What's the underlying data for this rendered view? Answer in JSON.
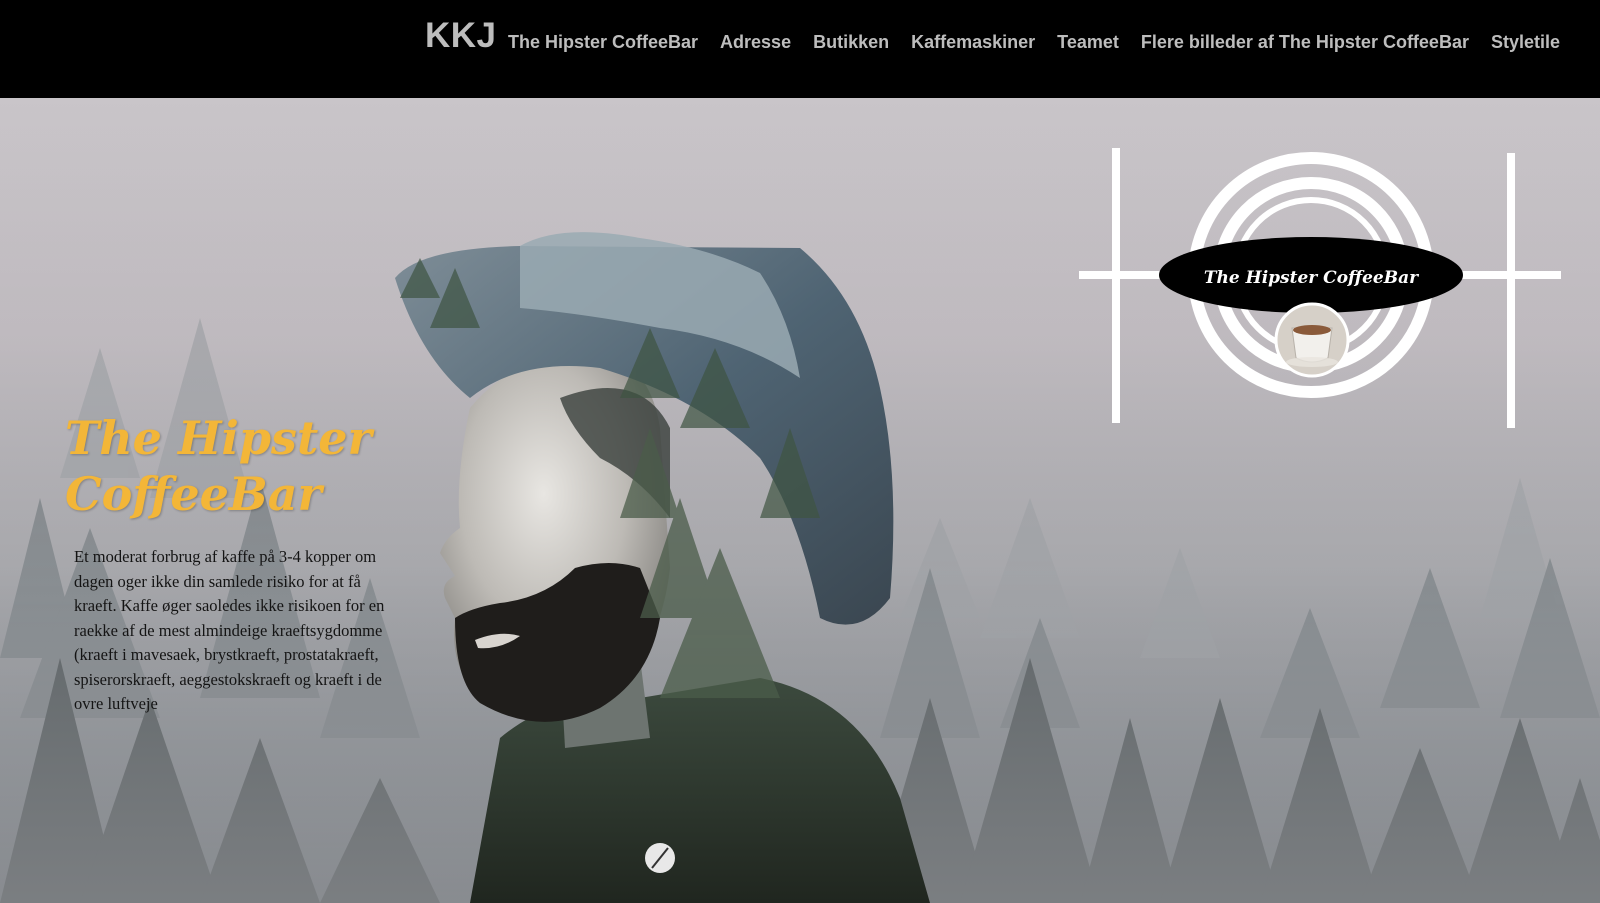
{
  "nav": {
    "brand": "KKJ",
    "items": [
      {
        "label": "The Hipster CoffeeBar"
      },
      {
        "label": "Adresse"
      },
      {
        "label": "Butikken"
      },
      {
        "label": "Kaffemaskiner"
      },
      {
        "label": "Teamet"
      },
      {
        "label": "Flere billeder af The Hipster CoffeeBar"
      },
      {
        "label": "Styletile"
      }
    ]
  },
  "hero": {
    "title_line1": "The Hipster",
    "title_line2": "CoffeeBar",
    "body": "Et moderat forbrug af kaffe på 3-4 kopper om dagen oger ikke din samlede risiko for at få kraeft. Kaffe øger saoledes ikke risikoen for en raekke af de mest almindeige kraeftsygdomme (kraeft i mavesaek, brystkraeft, prostatakraeft, spiserorskraeft, aeggestokskraeft og kraeft i de ovre luftveje",
    "image": "double-exposure-portrait-hat-beard-forest"
  },
  "logo": {
    "text": "The Hipster CoffeeBar",
    "image": "coffee-cup-photo"
  },
  "colors": {
    "nav_bg": "#000000",
    "nav_text": "#bdbdbd",
    "title_accent": "#f3b638",
    "body_text": "#141414"
  }
}
